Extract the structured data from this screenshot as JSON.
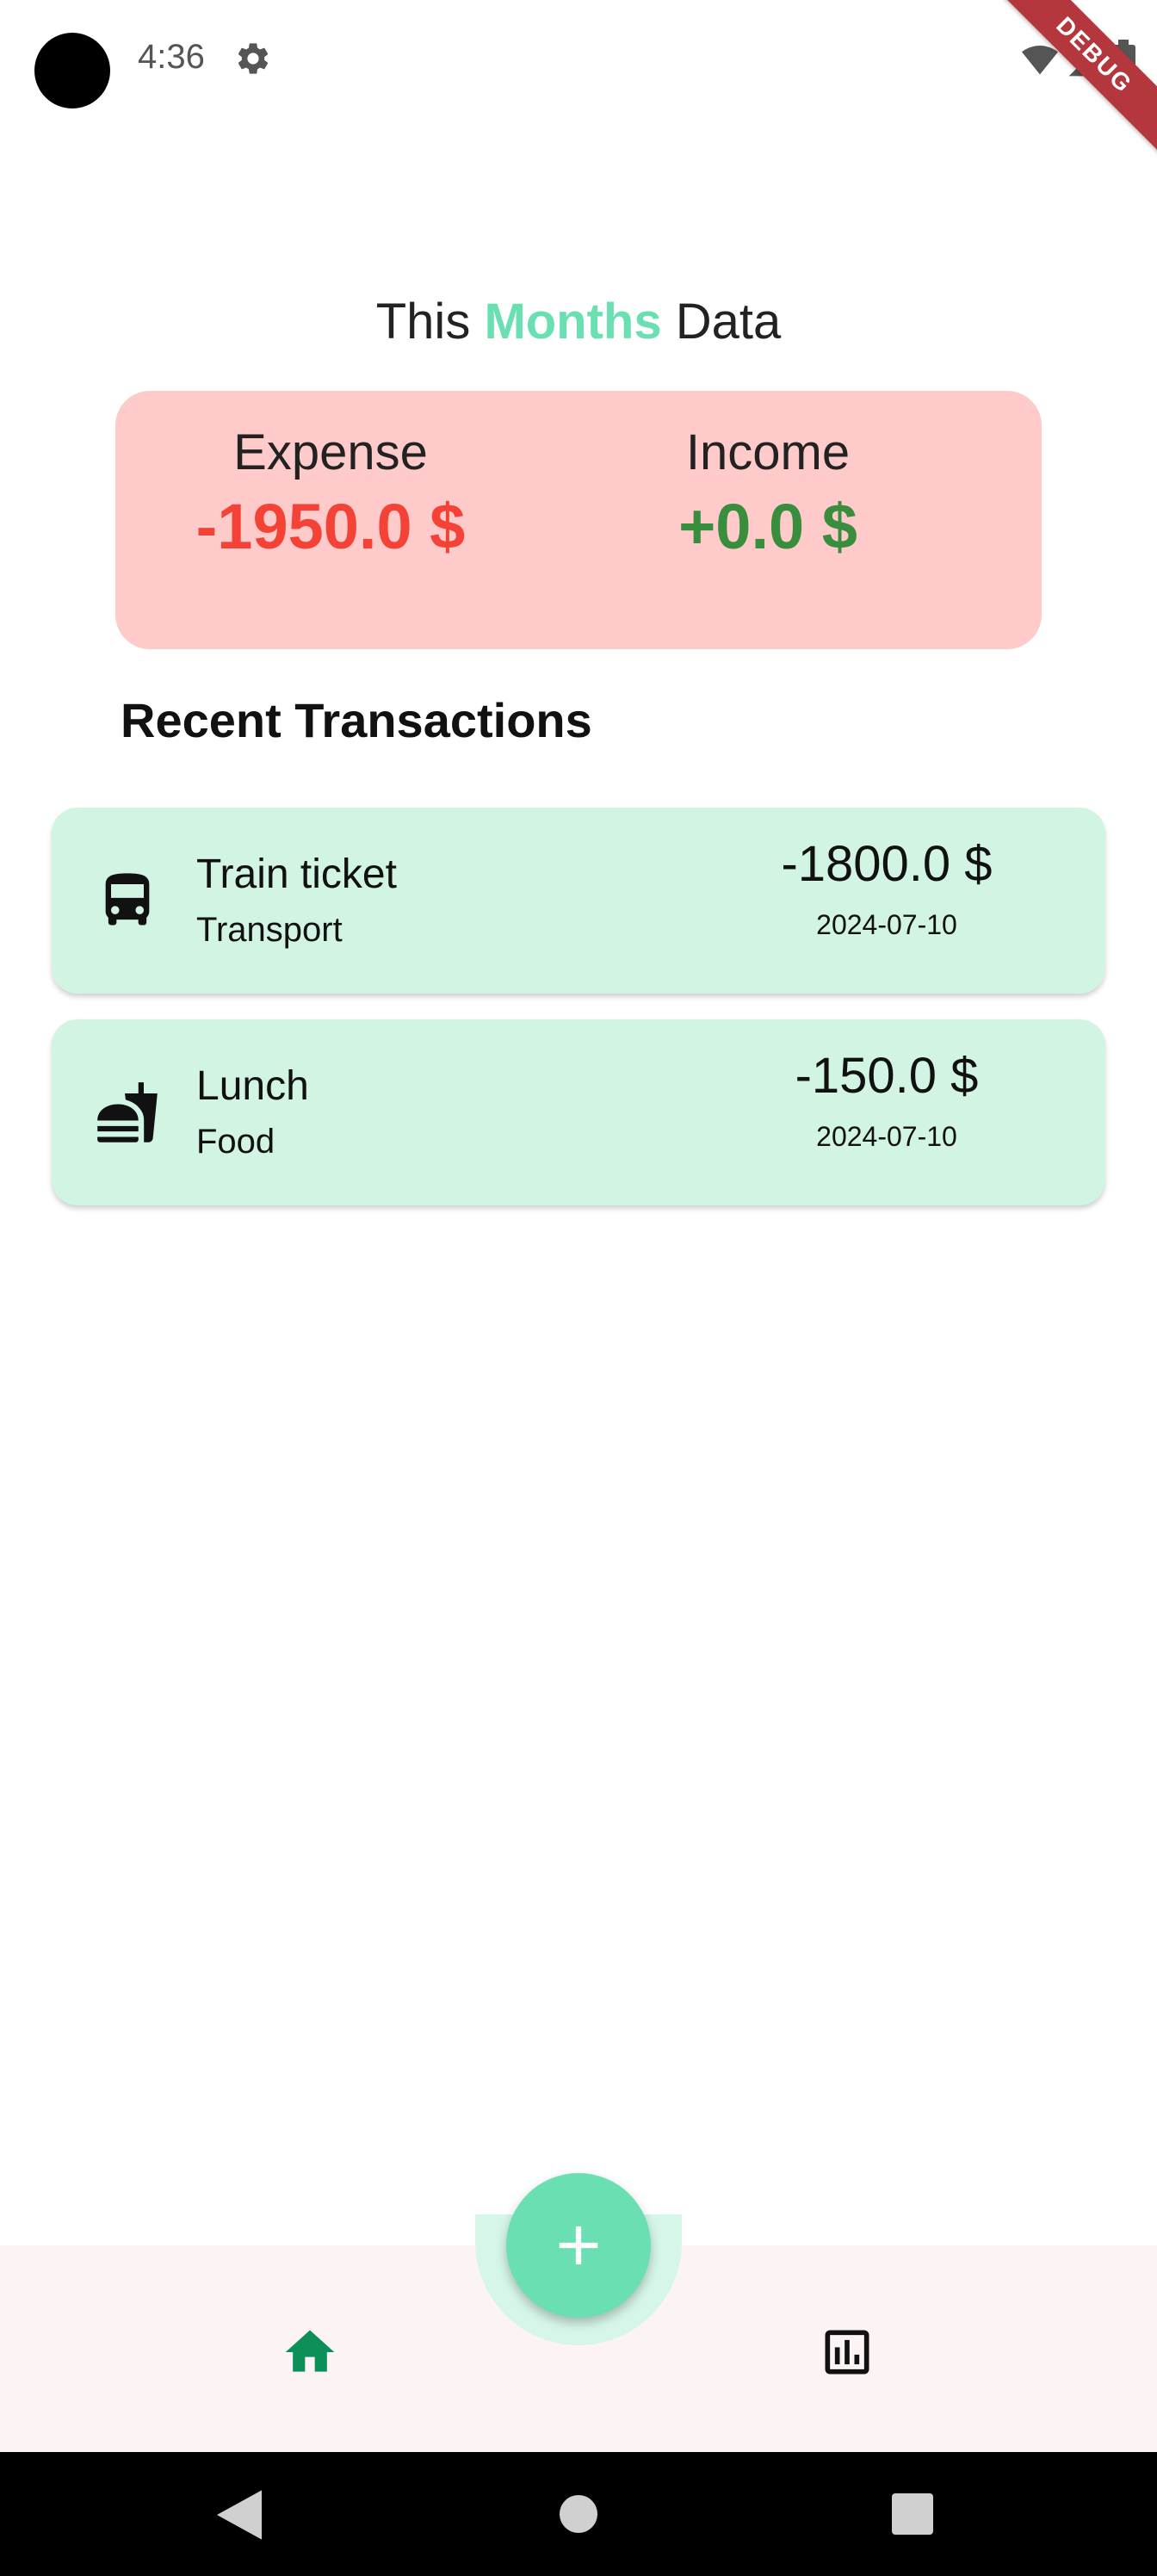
{
  "status_bar": {
    "time": "4:36",
    "icons": [
      "settings-icon",
      "wifi-icon",
      "signal-icon",
      "battery-icon"
    ],
    "debug_label": "DEBUG"
  },
  "header": {
    "title_prefix": "This ",
    "title_accent": "Months",
    "title_suffix": " Data"
  },
  "summary": {
    "expense_label": "Expense",
    "expense_value": "-1950.0 $",
    "income_label": "Income",
    "income_value": "+0.0 $"
  },
  "recent": {
    "title": "Recent Transactions",
    "transactions": [
      {
        "icon": "bus-icon",
        "title": "Train ticket",
        "category": "Transport",
        "amount": "-1800.0 $",
        "date": "2024-07-10"
      },
      {
        "icon": "fastfood-icon",
        "title": "Lunch",
        "category": "Food",
        "amount": "-150.0 $",
        "date": "2024-07-10"
      }
    ]
  },
  "bottom_nav": {
    "items": [
      "home-icon",
      "stats-icon"
    ],
    "fab_icon": "plus-icon"
  },
  "colors": {
    "accent": "#6ae0b2",
    "summary_bg": "#ffcaca",
    "expense": "#f44336",
    "income": "#388e3c",
    "tx_bg": "#d2f4e2",
    "home_active": "#0d8f5a"
  }
}
